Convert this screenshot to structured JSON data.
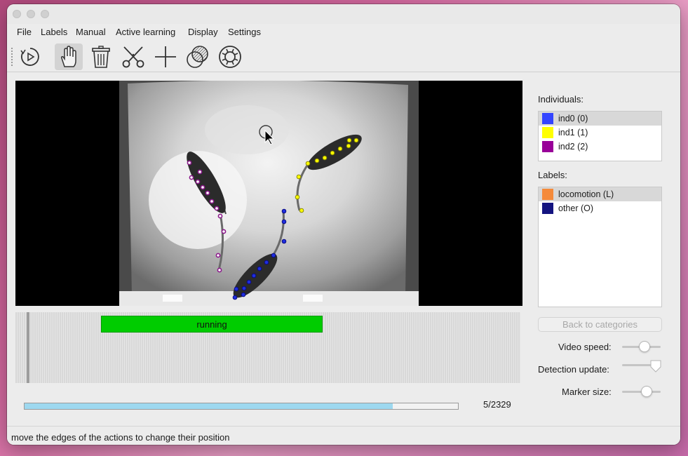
{
  "menu": [
    "File",
    "Labels",
    "Manual",
    "Active learning",
    "Display",
    "Settings"
  ],
  "toolbar": {
    "icons": [
      "play-icon",
      "hand-icon",
      "trash-icon",
      "scissors-icon",
      "plus-icon",
      "overlap-icon",
      "lifebuoy-icon"
    ],
    "active": "hand-icon"
  },
  "timeline": {
    "action_label": "running",
    "action_color": "#00cc00"
  },
  "progress": {
    "fraction": 0.85
  },
  "frame_counter": "5/2329",
  "individuals": {
    "title": "Individuals:",
    "items": [
      {
        "label": "ind0 (0)",
        "color": "#3344ff",
        "selected": true
      },
      {
        "label": "ind1 (1)",
        "color": "#ffff00",
        "selected": false
      },
      {
        "label": "ind2 (2)",
        "color": "#990099",
        "selected": false
      }
    ]
  },
  "labels": {
    "title": "Labels:",
    "items": [
      {
        "label": "locomotion (L)",
        "color": "#f58a3a",
        "selected": true
      },
      {
        "label": "other (O)",
        "color": "#141480",
        "selected": false
      }
    ]
  },
  "back_button": "Back to categories",
  "controls": {
    "video_speed": {
      "label": "Video speed:"
    },
    "detection_update": {
      "label": "Detection update:"
    },
    "marker_size": {
      "label": "Marker size:"
    }
  },
  "status": "move the edges of the actions to change their position"
}
